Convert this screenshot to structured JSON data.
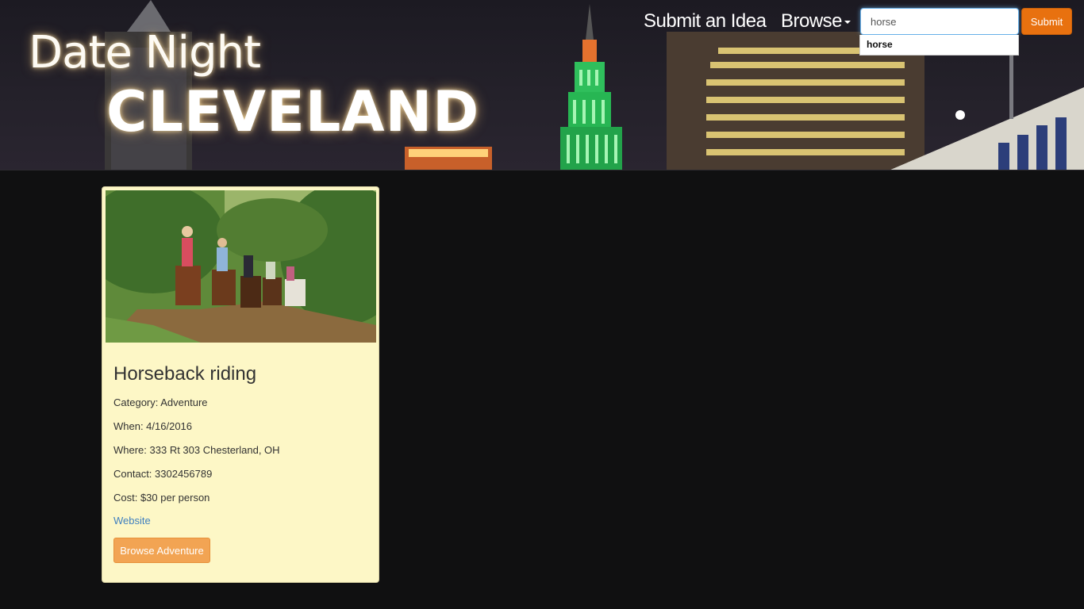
{
  "header": {
    "logo_line1": "Date Night",
    "logo_line2": "CLEVELAND",
    "nav": {
      "submit_idea_label": "Submit an Idea",
      "browse_label": "Browse"
    },
    "search": {
      "value": "horse",
      "submit_label": "Submit",
      "suggestions": [
        "horse"
      ]
    }
  },
  "card": {
    "title": "Horseback riding",
    "category": "Category: Adventure",
    "when": "When: 4/16/2016",
    "where": "Where: 333 Rt 303 Chesterland, OH",
    "contact": "Contact: 3302456789",
    "cost": "Cost: $30 per person",
    "website_label": "Website",
    "browse_button_label": "Browse Adventure"
  },
  "colors": {
    "page_background": "#101011",
    "card_background": "#fdf7c6",
    "submit_button": "#e8710f",
    "browse_button": "#f2a453",
    "link": "#3f7fbf"
  }
}
